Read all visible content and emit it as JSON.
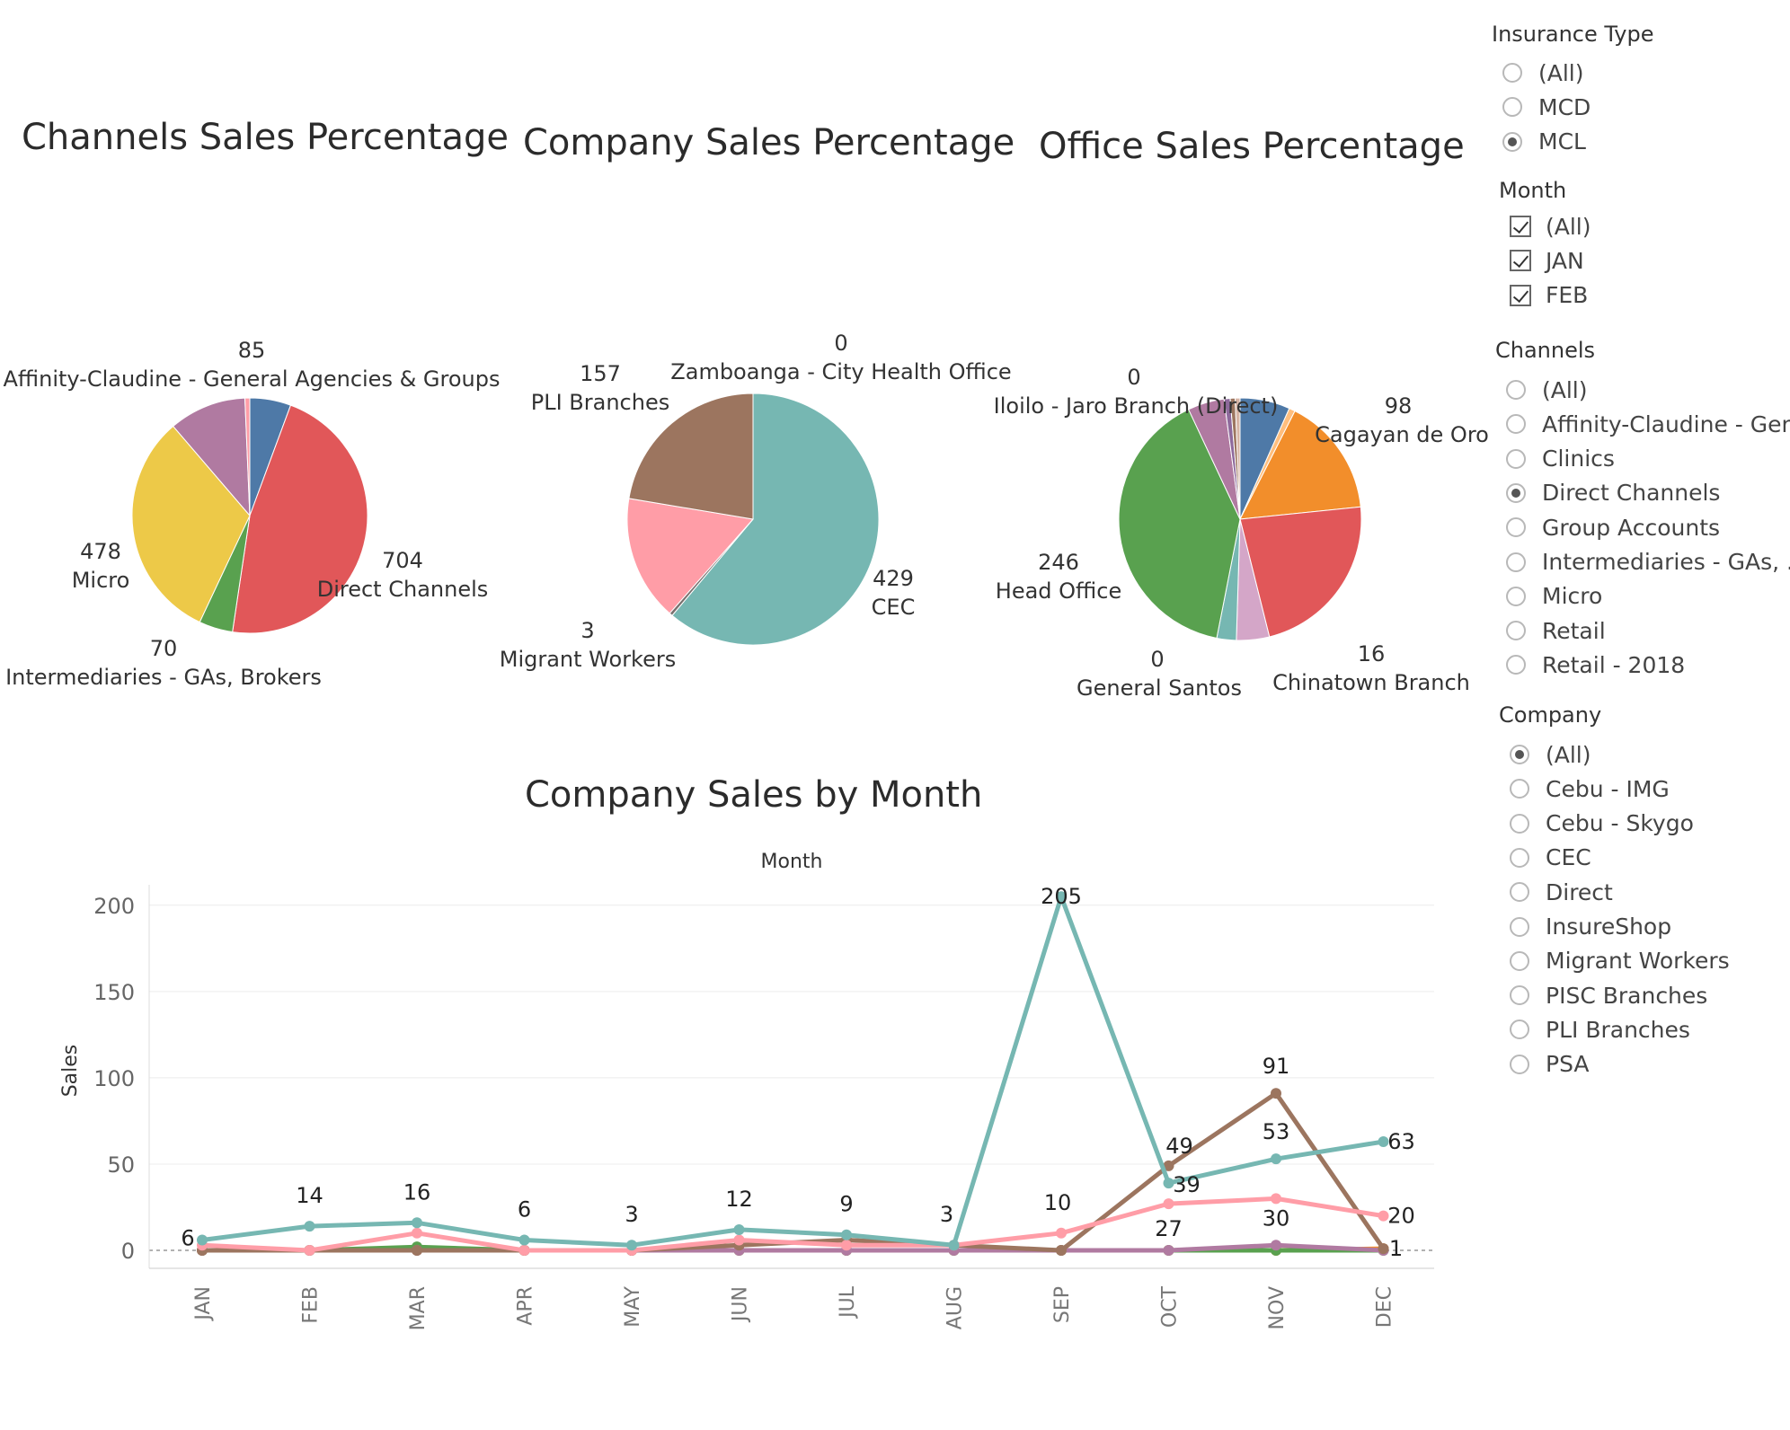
{
  "titles": {
    "channels": "Channels Sales Percentage",
    "company": "Company Sales Percentage",
    "office": "Office Sales Percentage",
    "by_month": "Company Sales by Month"
  },
  "pie_labels": {
    "channels": [
      {
        "value": "85",
        "name": "Affinity-Claudine - General Agencies & Groups"
      },
      {
        "value": "704",
        "name": "Direct Channels"
      },
      {
        "value": "478",
        "name": "Micro"
      },
      {
        "value": "70",
        "name": "Intermediaries - GAs, Brokers"
      }
    ],
    "company": [
      {
        "value": "157",
        "name": "PLI Branches"
      },
      {
        "value": "0",
        "name": "Zamboanga - City Health Office"
      },
      {
        "value": "429",
        "name": "CEC"
      },
      {
        "value": "3",
        "name": "Migrant Workers"
      }
    ],
    "office": [
      {
        "value": "0",
        "name": "Iloilo - Jaro Branch (Direct)"
      },
      {
        "value": "98",
        "name": "Cagayan de Oro"
      },
      {
        "value": "246",
        "name": "Head Office"
      },
      {
        "value": "0",
        "name": "General Santos"
      },
      {
        "value": "16",
        "name": "Chinatown Branch"
      }
    ]
  },
  "chart_data": [
    {
      "type": "pie",
      "title": "Channels Sales Percentage",
      "slices": [
        {
          "label": "Affinity-Claudine - General Agencies & Groups",
          "value": 85,
          "color": "#4e79a7"
        },
        {
          "label": "Direct Channels",
          "value": 704,
          "color": "#e15759"
        },
        {
          "label": "Intermediaries - GAs, Brokers",
          "value": 70,
          "color": "#59a14f"
        },
        {
          "label": "Micro",
          "value": 478,
          "color": "#edc948"
        },
        {
          "label": "Group Accounts",
          "value": 160,
          "color": "#b07aa1"
        },
        {
          "label": "Retail",
          "value": 10,
          "color": "#ff9da7"
        }
      ]
    },
    {
      "type": "pie",
      "title": "Company Sales Percentage",
      "slices": [
        {
          "label": "CEC",
          "value": 429,
          "color": "#76b7b2"
        },
        {
          "label": "Migrant Workers",
          "value": 3,
          "color": "#79706e"
        },
        {
          "label": "PISC Branches",
          "value": 113,
          "color": "#ff9da7"
        },
        {
          "label": "PLI Branches",
          "value": 157,
          "color": "#9c755f"
        },
        {
          "label": "Zamboanga - City Health Office",
          "value": 0,
          "color": "#bab0ac"
        }
      ]
    },
    {
      "type": "pie",
      "title": "Office Sales Percentage",
      "slices": [
        {
          "label": "",
          "value": 41,
          "color": "#4e79a7"
        },
        {
          "label": "",
          "value": 5,
          "color": "#ffbe7d"
        },
        {
          "label": "Cagayan de Oro",
          "value": 98,
          "color": "#f28e2b"
        },
        {
          "label": "",
          "value": 140,
          "color": "#e15759"
        },
        {
          "label": "",
          "value": 27,
          "color": "#d4a6c8"
        },
        {
          "label": "Chinatown Branch",
          "value": 16,
          "color": "#76b7b2"
        },
        {
          "label": "Head Office",
          "value": 246,
          "color": "#59a14f"
        },
        {
          "label": "",
          "value": 30,
          "color": "#b07aa1"
        },
        {
          "label": "",
          "value": 5,
          "color": "#8e6a9c"
        },
        {
          "label": "",
          "value": 4,
          "color": "#9c755f"
        },
        {
          "label": "",
          "value": 4,
          "color": "#d7b5a6"
        }
      ]
    },
    {
      "type": "line",
      "title": "Company Sales by Month",
      "xlabel": "Month",
      "ylabel": "Sales",
      "categories": [
        "JAN",
        "FEB",
        "MAR",
        "APR",
        "MAY",
        "JUN",
        "JUL",
        "AUG",
        "SEP",
        "OCT",
        "NOV",
        "DEC"
      ],
      "ylim": [
        0,
        210
      ],
      "yticks": [
        0,
        50,
        100,
        150,
        200
      ],
      "series": [
        {
          "color": "#f28e2b",
          "values": [
            0,
            0,
            0,
            0,
            0,
            0,
            0,
            0,
            0,
            0,
            0,
            1
          ]
        },
        {
          "color": "#59a14f",
          "values": [
            0,
            0,
            2,
            0,
            0,
            0,
            0,
            0,
            0,
            0,
            0,
            0
          ]
        },
        {
          "color": "#b07aa1",
          "values": [
            0,
            0,
            0,
            0,
            0,
            0,
            0,
            0,
            0,
            0,
            3,
            0
          ]
        },
        {
          "color": "#9c755f",
          "values": [
            0,
            0,
            0,
            0,
            0,
            3,
            6,
            3,
            0,
            49,
            91,
            1
          ]
        },
        {
          "color": "#ff9da7",
          "values": [
            3,
            0,
            10,
            0,
            0,
            6,
            3,
            3,
            10,
            27,
            30,
            20
          ]
        },
        {
          "color": "#76b7b2",
          "values": [
            6,
            14,
            16,
            6,
            3,
            12,
            9,
            3,
            205,
            39,
            53,
            63
          ]
        }
      ],
      "data_labels": [
        {
          "text": "6",
          "cat": 0,
          "y": 6,
          "dx": -16,
          "dy": 6
        },
        {
          "text": "14",
          "cat": 1,
          "y": 14,
          "dx": 0,
          "dy": -26
        },
        {
          "text": "16",
          "cat": 2,
          "y": 16,
          "dx": 0,
          "dy": -26
        },
        {
          "text": "6",
          "cat": 3,
          "y": 6,
          "dx": 0,
          "dy": -26
        },
        {
          "text": "3",
          "cat": 4,
          "y": 3,
          "dx": 0,
          "dy": -26
        },
        {
          "text": "12",
          "cat": 5,
          "y": 12,
          "dx": 0,
          "dy": -26
        },
        {
          "text": "9",
          "cat": 6,
          "y": 9,
          "dx": 0,
          "dy": -26
        },
        {
          "text": "3",
          "cat": 7,
          "y": 3,
          "dx": -8,
          "dy": -26
        },
        {
          "text": "205",
          "cat": 8,
          "y": 205,
          "dx": 0,
          "dy": 8
        },
        {
          "text": "10",
          "cat": 8,
          "y": 10,
          "dx": -4,
          "dy": -26
        },
        {
          "text": "49",
          "cat": 9,
          "y": 49,
          "dx": 12,
          "dy": -14
        },
        {
          "text": "39",
          "cat": 9,
          "y": 39,
          "dx": 20,
          "dy": 10
        },
        {
          "text": "27",
          "cat": 9,
          "y": 27,
          "dx": 0,
          "dy": 36
        },
        {
          "text": "91",
          "cat": 10,
          "y": 91,
          "dx": 0,
          "dy": -22
        },
        {
          "text": "53",
          "cat": 10,
          "y": 53,
          "dx": 0,
          "dy": -22
        },
        {
          "text": "30",
          "cat": 10,
          "y": 30,
          "dx": 0,
          "dy": 30
        },
        {
          "text": "63",
          "cat": 11,
          "y": 63,
          "dx": 20,
          "dy": 8
        },
        {
          "text": "20",
          "cat": 11,
          "y": 20,
          "dx": 20,
          "dy": 8
        },
        {
          "text": "1",
          "cat": 11,
          "y": 1,
          "dx": 14,
          "dy": 8
        }
      ]
    }
  ],
  "filters": {
    "insurance_type": {
      "title": "Insurance Type",
      "items": [
        "(All)",
        "MCD",
        "MCL"
      ],
      "selected": 2
    },
    "month": {
      "title": "Month",
      "items": [
        "(All)",
        "JAN",
        "FEB"
      ]
    },
    "channels": {
      "title": "Channels",
      "items": [
        "(All)",
        "Affinity-Claudine - Gen...",
        "Clinics",
        "Direct Channels",
        "Group Accounts",
        "Intermediaries - GAs, ...",
        "Micro",
        "Retail",
        "Retail - 2018"
      ],
      "selected": 3
    },
    "company": {
      "title": "Company",
      "items": [
        "(All)",
        "Cebu - IMG",
        "Cebu - Skygo",
        "CEC",
        "Direct",
        "InsureShop",
        "Migrant Workers",
        "PISC Branches",
        "PLI Branches",
        "PSA"
      ],
      "selected": 0
    }
  }
}
